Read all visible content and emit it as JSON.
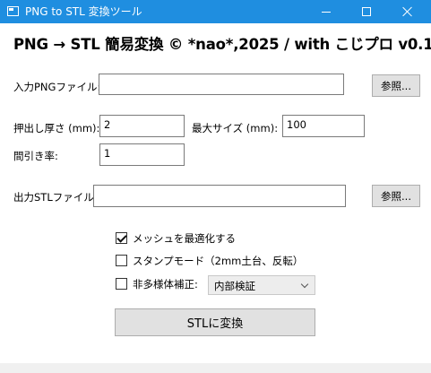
{
  "window": {
    "title": "PNG to STL 変換ツール",
    "controls": [
      "minimize-icon",
      "maximize-icon",
      "close-icon"
    ]
  },
  "heading": "PNG → STL 簡易変換 © *nao*,2025 / with こじプロ v0.1",
  "input_png": {
    "label": "入力PNGファイル:",
    "value": "",
    "browse_label": "参照..."
  },
  "extrude": {
    "label": "押出し厚さ (mm):",
    "value": "2"
  },
  "max_size": {
    "label": "最大サイズ (mm):",
    "value": "100"
  },
  "thinning": {
    "label": "間引き率:",
    "value": "1"
  },
  "output_stl": {
    "label": "出力STLファイル:",
    "value": "",
    "browse_label": "参照..."
  },
  "options": {
    "optimize_mesh": {
      "label": "メッシュを最適化する",
      "checked": true
    },
    "stamp_mode": {
      "label": "スタンプモード（2mm土台、反転）",
      "checked": false
    },
    "nonmanifold_fix": {
      "label": "非多様体補正:",
      "checked": false
    },
    "fix_method": {
      "selected": "内部検証"
    }
  },
  "convert_button": "STLに変換"
}
